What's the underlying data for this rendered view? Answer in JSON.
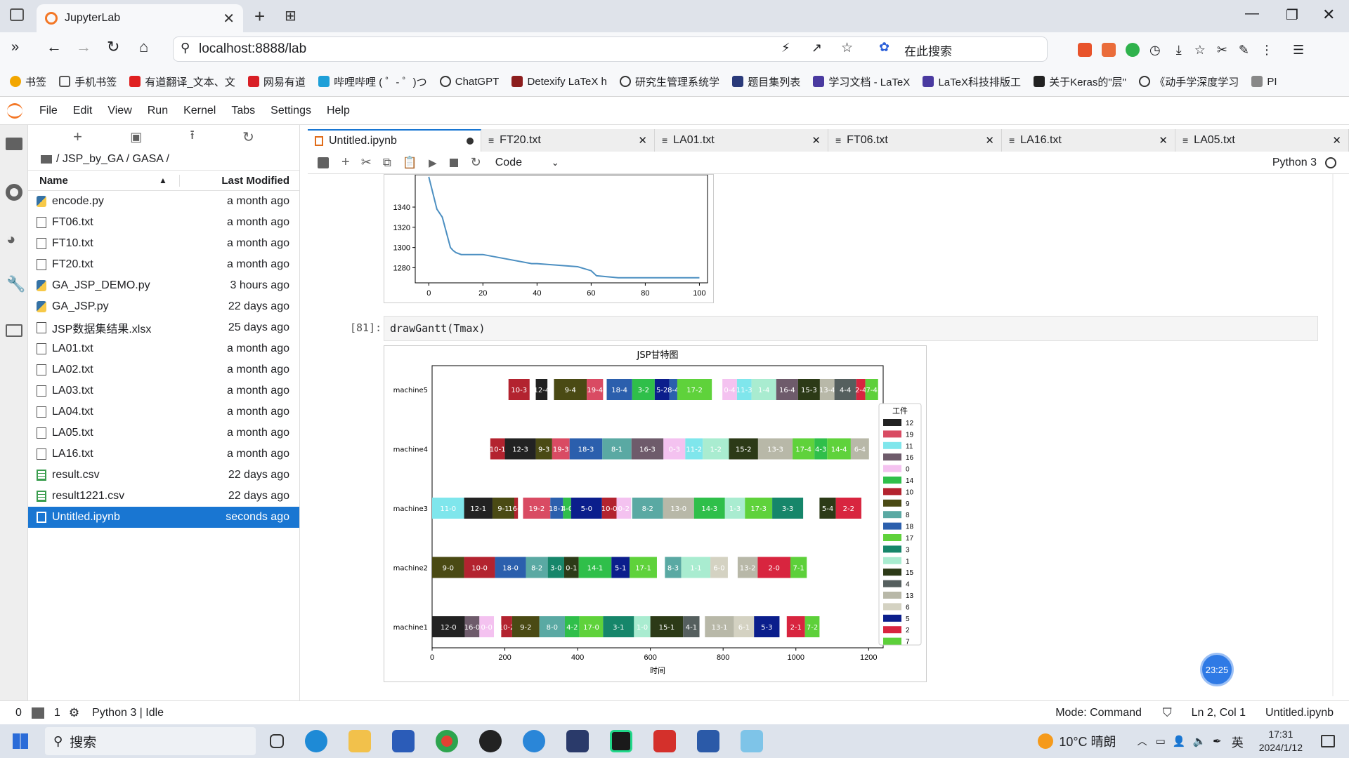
{
  "browser": {
    "tab_title": "JupyterLab",
    "url": "localhost:8888/lab",
    "search_label": "在此搜索",
    "bookmarks": [
      "书签",
      "手机书签",
      "有道翻译_文本、文",
      "网易有道",
      "哔哩哔哩 ( ゜- ゜)つ",
      "ChatGPT",
      "Detexify LaTeX h",
      "研究生管理系统学",
      "题目集列表",
      "学习文档 - LaTeX",
      "LaTeX科技排版工",
      "关于Keras的\"层\"",
      "《动手学深度学习",
      "PI"
    ]
  },
  "jupyter": {
    "menu": [
      "File",
      "Edit",
      "View",
      "Run",
      "Kernel",
      "Tabs",
      "Settings",
      "Help"
    ],
    "breadcrumb": "/ JSP_by_GA / GASA /",
    "col_name": "Name",
    "col_modified": "Last Modified",
    "files": [
      {
        "name": "encode.py",
        "mod": "a month ago",
        "type": "py"
      },
      {
        "name": "FT06.txt",
        "mod": "a month ago",
        "type": "txt"
      },
      {
        "name": "FT10.txt",
        "mod": "a month ago",
        "type": "txt"
      },
      {
        "name": "FT20.txt",
        "mod": "a month ago",
        "type": "txt"
      },
      {
        "name": "GA_JSP_DEMO.py",
        "mod": "3 hours ago",
        "type": "py"
      },
      {
        "name": "GA_JSP.py",
        "mod": "22 days ago",
        "type": "py"
      },
      {
        "name": "JSP数据集结果.xlsx",
        "mod": "25 days ago",
        "type": "txt"
      },
      {
        "name": "LA01.txt",
        "mod": "a month ago",
        "type": "txt"
      },
      {
        "name": "LA02.txt",
        "mod": "a month ago",
        "type": "txt"
      },
      {
        "name": "LA03.txt",
        "mod": "a month ago",
        "type": "txt"
      },
      {
        "name": "LA04.txt",
        "mod": "a month ago",
        "type": "txt"
      },
      {
        "name": "LA05.txt",
        "mod": "a month ago",
        "type": "txt"
      },
      {
        "name": "LA16.txt",
        "mod": "a month ago",
        "type": "txt"
      },
      {
        "name": "result.csv",
        "mod": "22 days ago",
        "type": "csv"
      },
      {
        "name": "result1221.csv",
        "mod": "22 days ago",
        "type": "csv"
      },
      {
        "name": "Untitled.ipynb",
        "mod": "seconds ago",
        "type": "nb",
        "selected": true
      }
    ],
    "tabs": [
      "Untitled.ipynb",
      "FT20.txt",
      "LA01.txt",
      "FT06.txt",
      "LA16.txt",
      "LA05.txt"
    ],
    "cell_type": "Code",
    "kernel": "Python 3",
    "cell_prompt": "[81]:",
    "cell_code_fn": "drawGantt",
    "cell_code_arg": "Tmax",
    "status_left": "Python 3 | Idle",
    "status_left_nums": [
      "0",
      "1"
    ],
    "status_mode": "Mode: Command",
    "status_pos": "Ln 2, Col 1",
    "status_file": "Untitled.ipynb",
    "timer": "23:25"
  },
  "taskbar": {
    "search": "搜索",
    "weather": "10°C 晴朗",
    "ime": "英",
    "time": "17:31",
    "date": "2024/1/12"
  },
  "chart_data": [
    {
      "type": "line",
      "title": "",
      "x": [
        0,
        3,
        5,
        6,
        8,
        9,
        10,
        12,
        15,
        20,
        38,
        40,
        55,
        60,
        62,
        70,
        100
      ],
      "y": [
        1370,
        1338,
        1330,
        1320,
        1300,
        1297,
        1295,
        1293,
        1293,
        1293,
        1284,
        1284,
        1281,
        1277,
        1272,
        1270,
        1270
      ],
      "xlim": [
        -5,
        103
      ],
      "ylim": [
        1265,
        1372
      ],
      "xticks": [
        0,
        20,
        40,
        60,
        80,
        100
      ],
      "yticks": [
        1280,
        1300,
        1320,
        1340
      ],
      "color": "#4c8fc1"
    },
    {
      "type": "gantt",
      "title": "JSP甘特图",
      "xlabel": "时间",
      "xlim": [
        0,
        1240
      ],
      "xticks": [
        0,
        200,
        400,
        600,
        800,
        1000,
        1200
      ],
      "machines": [
        "machine5",
        "machine4",
        "machine3",
        "machine2",
        "machine1"
      ],
      "legend_title": "工件",
      "legend": [
        {
          "label": "12",
          "color": "#222222"
        },
        {
          "label": "19",
          "color": "#d94b63"
        },
        {
          "label": "11",
          "color": "#7fe6ec"
        },
        {
          "label": "16",
          "color": "#6e5b6b"
        },
        {
          "label": "0",
          "color": "#f4c2f0"
        },
        {
          "label": "14",
          "color": "#2fbf4a"
        },
        {
          "label": "10",
          "color": "#b3232f"
        },
        {
          "label": "9",
          "color": "#4a4a14"
        },
        {
          "label": "8",
          "color": "#5aa9a3"
        },
        {
          "label": "18",
          "color": "#2b5fad"
        },
        {
          "label": "17",
          "color": "#5fd23b"
        },
        {
          "label": "3",
          "color": "#16866a"
        },
        {
          "label": "1",
          "color": "#a9ecd0"
        },
        {
          "label": "15",
          "color": "#2c3a17"
        },
        {
          "label": "4",
          "color": "#555f5e"
        },
        {
          "label": "13",
          "color": "#b8b8a8"
        },
        {
          "label": "6",
          "color": "#d4d2c2"
        },
        {
          "label": "5",
          "color": "#0b1e8c"
        },
        {
          "label": "2",
          "color": "#d8253f"
        },
        {
          "label": "7",
          "color": "#5dd03a"
        }
      ],
      "bars": [
        {
          "m": 0,
          "s": 210,
          "d": 58,
          "j": "10",
          "l": "10-3"
        },
        {
          "m": 0,
          "s": 285,
          "d": 32,
          "j": "12",
          "l": "12-4"
        },
        {
          "m": 0,
          "s": 335,
          "d": 90,
          "j": "9",
          "l": "9-4"
        },
        {
          "m": 0,
          "s": 425,
          "d": 45,
          "j": "19",
          "l": "19-4"
        },
        {
          "m": 0,
          "s": 480,
          "d": 70,
          "j": "18",
          "l": "18-4"
        },
        {
          "m": 0,
          "s": 550,
          "d": 62,
          "j": "14",
          "l": "3-2"
        },
        {
          "m": 0,
          "s": 612,
          "d": 40,
          "j": "5",
          "l": "5-2"
        },
        {
          "m": 0,
          "s": 652,
          "d": 22,
          "j": "18",
          "l": "8-4"
        },
        {
          "m": 0,
          "s": 674,
          "d": 95,
          "j": "17",
          "l": "17-2"
        },
        {
          "m": 0,
          "s": 798,
          "d": 40,
          "j": "0",
          "l": "0-4"
        },
        {
          "m": 0,
          "s": 838,
          "d": 40,
          "j": "11",
          "l": "11-3"
        },
        {
          "m": 0,
          "s": 878,
          "d": 68,
          "j": "1",
          "l": "1-4"
        },
        {
          "m": 0,
          "s": 946,
          "d": 60,
          "j": "16",
          "l": "16-4"
        },
        {
          "m": 0,
          "s": 1006,
          "d": 60,
          "j": "15",
          "l": "15-3"
        },
        {
          "m": 0,
          "s": 1066,
          "d": 40,
          "j": "13",
          "l": "13-4"
        },
        {
          "m": 0,
          "s": 1106,
          "d": 60,
          "j": "4",
          "l": "4-4"
        },
        {
          "m": 0,
          "s": 1166,
          "d": 25,
          "j": "2",
          "l": "2-4"
        },
        {
          "m": 0,
          "s": 1191,
          "d": 35,
          "j": "7",
          "l": "7-4"
        },
        {
          "m": 1,
          "s": 160,
          "d": 40,
          "j": "10",
          "l": "10-1"
        },
        {
          "m": 1,
          "s": 200,
          "d": 85,
          "j": "12",
          "l": "12-3"
        },
        {
          "m": 1,
          "s": 285,
          "d": 45,
          "j": "9",
          "l": "9-3"
        },
        {
          "m": 1,
          "s": 330,
          "d": 48,
          "j": "19",
          "l": "19-3"
        },
        {
          "m": 1,
          "s": 378,
          "d": 90,
          "j": "18",
          "l": "18-3"
        },
        {
          "m": 1,
          "s": 468,
          "d": 80,
          "j": "8",
          "l": "8-1"
        },
        {
          "m": 1,
          "s": 548,
          "d": 88,
          "j": "16",
          "l": "16-3"
        },
        {
          "m": 1,
          "s": 636,
          "d": 60,
          "j": "0",
          "l": "0-3"
        },
        {
          "m": 1,
          "s": 696,
          "d": 48,
          "j": "11",
          "l": "11-2"
        },
        {
          "m": 1,
          "s": 744,
          "d": 72,
          "j": "1",
          "l": "1-2"
        },
        {
          "m": 1,
          "s": 816,
          "d": 80,
          "j": "15",
          "l": "15-2"
        },
        {
          "m": 1,
          "s": 896,
          "d": 95,
          "j": "13",
          "l": "13-3"
        },
        {
          "m": 1,
          "s": 991,
          "d": 60,
          "j": "17",
          "l": "17-4"
        },
        {
          "m": 1,
          "s": 1051,
          "d": 35,
          "j": "14",
          "l": "4-3"
        },
        {
          "m": 1,
          "s": 1086,
          "d": 65,
          "j": "17",
          "l": "14-4"
        },
        {
          "m": 1,
          "s": 1151,
          "d": 50,
          "j": "13",
          "l": "6-4"
        },
        {
          "m": 2,
          "s": 0,
          "d": 88,
          "j": "11",
          "l": "11-0"
        },
        {
          "m": 2,
          "s": 88,
          "d": 78,
          "j": "12",
          "l": "12-1"
        },
        {
          "m": 2,
          "s": 166,
          "d": 60,
          "j": "9",
          "l": "9-1"
        },
        {
          "m": 2,
          "s": 226,
          "d": 10,
          "j": "10",
          "l": "16-1"
        },
        {
          "m": 2,
          "s": 250,
          "d": 75,
          "j": "19",
          "l": "19-2"
        },
        {
          "m": 2,
          "s": 325,
          "d": 35,
          "j": "18",
          "l": "18-1"
        },
        {
          "m": 2,
          "s": 360,
          "d": 22,
          "j": "14",
          "l": "4-0"
        },
        {
          "m": 2,
          "s": 382,
          "d": 85,
          "j": "5",
          "l": "5-0"
        },
        {
          "m": 2,
          "s": 467,
          "d": 40,
          "j": "10",
          "l": "10-0"
        },
        {
          "m": 2,
          "s": 507,
          "d": 40,
          "j": "0",
          "l": "0-2"
        },
        {
          "m": 2,
          "s": 550,
          "d": 85,
          "j": "8",
          "l": "8-2"
        },
        {
          "m": 2,
          "s": 635,
          "d": 85,
          "j": "13",
          "l": "13-0"
        },
        {
          "m": 2,
          "s": 720,
          "d": 85,
          "j": "14",
          "l": "14-3"
        },
        {
          "m": 2,
          "s": 805,
          "d": 55,
          "j": "1",
          "l": "1-3"
        },
        {
          "m": 2,
          "s": 860,
          "d": 75,
          "j": "17",
          "l": "17-3"
        },
        {
          "m": 2,
          "s": 935,
          "d": 85,
          "j": "3",
          "l": "3-3"
        },
        {
          "m": 2,
          "s": 1065,
          "d": 45,
          "j": "15",
          "l": "5-4"
        },
        {
          "m": 2,
          "s": 1110,
          "d": 70,
          "j": "2",
          "l": "2-2"
        },
        {
          "m": 3,
          "s": 0,
          "d": 88,
          "j": "9",
          "l": "9-0"
        },
        {
          "m": 3,
          "s": 88,
          "d": 85,
          "j": "10",
          "l": "10-0"
        },
        {
          "m": 3,
          "s": 173,
          "d": 85,
          "j": "18",
          "l": "18-0"
        },
        {
          "m": 3,
          "s": 258,
          "d": 60,
          "j": "8",
          "l": "8-2"
        },
        {
          "m": 3,
          "s": 318,
          "d": 45,
          "j": "3",
          "l": "3-0"
        },
        {
          "m": 3,
          "s": 363,
          "d": 40,
          "j": "15",
          "l": "0-1"
        },
        {
          "m": 3,
          "s": 403,
          "d": 90,
          "j": "14",
          "l": "14-1"
        },
        {
          "m": 3,
          "s": 493,
          "d": 50,
          "j": "5",
          "l": "5-1"
        },
        {
          "m": 3,
          "s": 543,
          "d": 75,
          "j": "17",
          "l": "17-1"
        },
        {
          "m": 3,
          "s": 640,
          "d": 45,
          "j": "8",
          "l": "8-3"
        },
        {
          "m": 3,
          "s": 685,
          "d": 80,
          "j": "1",
          "l": "1-1"
        },
        {
          "m": 3,
          "s": 765,
          "d": 48,
          "j": "6",
          "l": "6-0"
        },
        {
          "m": 3,
          "s": 840,
          "d": 55,
          "j": "13",
          "l": "13-2"
        },
        {
          "m": 3,
          "s": 895,
          "d": 90,
          "j": "2",
          "l": "2-0"
        },
        {
          "m": 3,
          "s": 985,
          "d": 45,
          "j": "7",
          "l": "7-1"
        },
        {
          "m": 4,
          "s": 0,
          "d": 90,
          "j": "12",
          "l": "12-0"
        },
        {
          "m": 4,
          "s": 90,
          "d": 40,
          "j": "16",
          "l": "16-0"
        },
        {
          "m": 4,
          "s": 130,
          "d": 40,
          "j": "0",
          "l": "0-0"
        },
        {
          "m": 4,
          "s": 190,
          "d": 30,
          "j": "10",
          "l": "10-2"
        },
        {
          "m": 4,
          "s": 220,
          "d": 75,
          "j": "9",
          "l": "9-2"
        },
        {
          "m": 4,
          "s": 295,
          "d": 70,
          "j": "8",
          "l": "8-0"
        },
        {
          "m": 4,
          "s": 365,
          "d": 40,
          "j": "14",
          "l": "4-2"
        },
        {
          "m": 4,
          "s": 405,
          "d": 65,
          "j": "17",
          "l": "17-0"
        },
        {
          "m": 4,
          "s": 470,
          "d": 85,
          "j": "3",
          "l": "3-1"
        },
        {
          "m": 4,
          "s": 555,
          "d": 45,
          "j": "1",
          "l": "1-0"
        },
        {
          "m": 4,
          "s": 600,
          "d": 90,
          "j": "15",
          "l": "15-1"
        },
        {
          "m": 4,
          "s": 690,
          "d": 45,
          "j": "4",
          "l": "4-1"
        },
        {
          "m": 4,
          "s": 750,
          "d": 80,
          "j": "13",
          "l": "13-1"
        },
        {
          "m": 4,
          "s": 830,
          "d": 55,
          "j": "6",
          "l": "6-1"
        },
        {
          "m": 4,
          "s": 885,
          "d": 70,
          "j": "5",
          "l": "5-3"
        },
        {
          "m": 4,
          "s": 975,
          "d": 50,
          "j": "2",
          "l": "2-1"
        },
        {
          "m": 4,
          "s": 1025,
          "d": 40,
          "j": "7",
          "l": "7-2"
        }
      ]
    }
  ]
}
